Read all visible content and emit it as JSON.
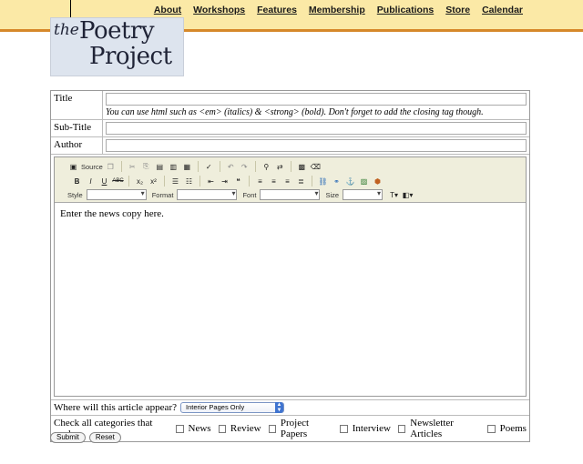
{
  "nav": [
    "About",
    "Workshops",
    "Features",
    "Membership",
    "Publications",
    "Store",
    "Calendar"
  ],
  "logo": {
    "the": "the",
    "line1": "Poetry",
    "line2": "Project"
  },
  "form": {
    "title_label": "Title",
    "title_hint": "You can use html such as <em> (italics) & <strong> (bold). Don't forget to add the closing tag though.",
    "subtitle_label": "Sub-Title",
    "author_label": "Author"
  },
  "toolbar": {
    "source": "Source",
    "style_label": "Style",
    "format_label": "Format",
    "font_label": "Font",
    "size_label": "Size"
  },
  "editor": {
    "content": "Enter the news copy here."
  },
  "placement": {
    "question": "Where will this article appear?",
    "selected": "Interior Pages Only"
  },
  "categories": {
    "prompt": "Check all categories that apply:",
    "items": [
      "News",
      "Review",
      "Project Papers",
      "Interview",
      "Newsletter Articles",
      "Poems"
    ]
  },
  "buttons": {
    "submit": "Submit",
    "reset": "Reset"
  }
}
